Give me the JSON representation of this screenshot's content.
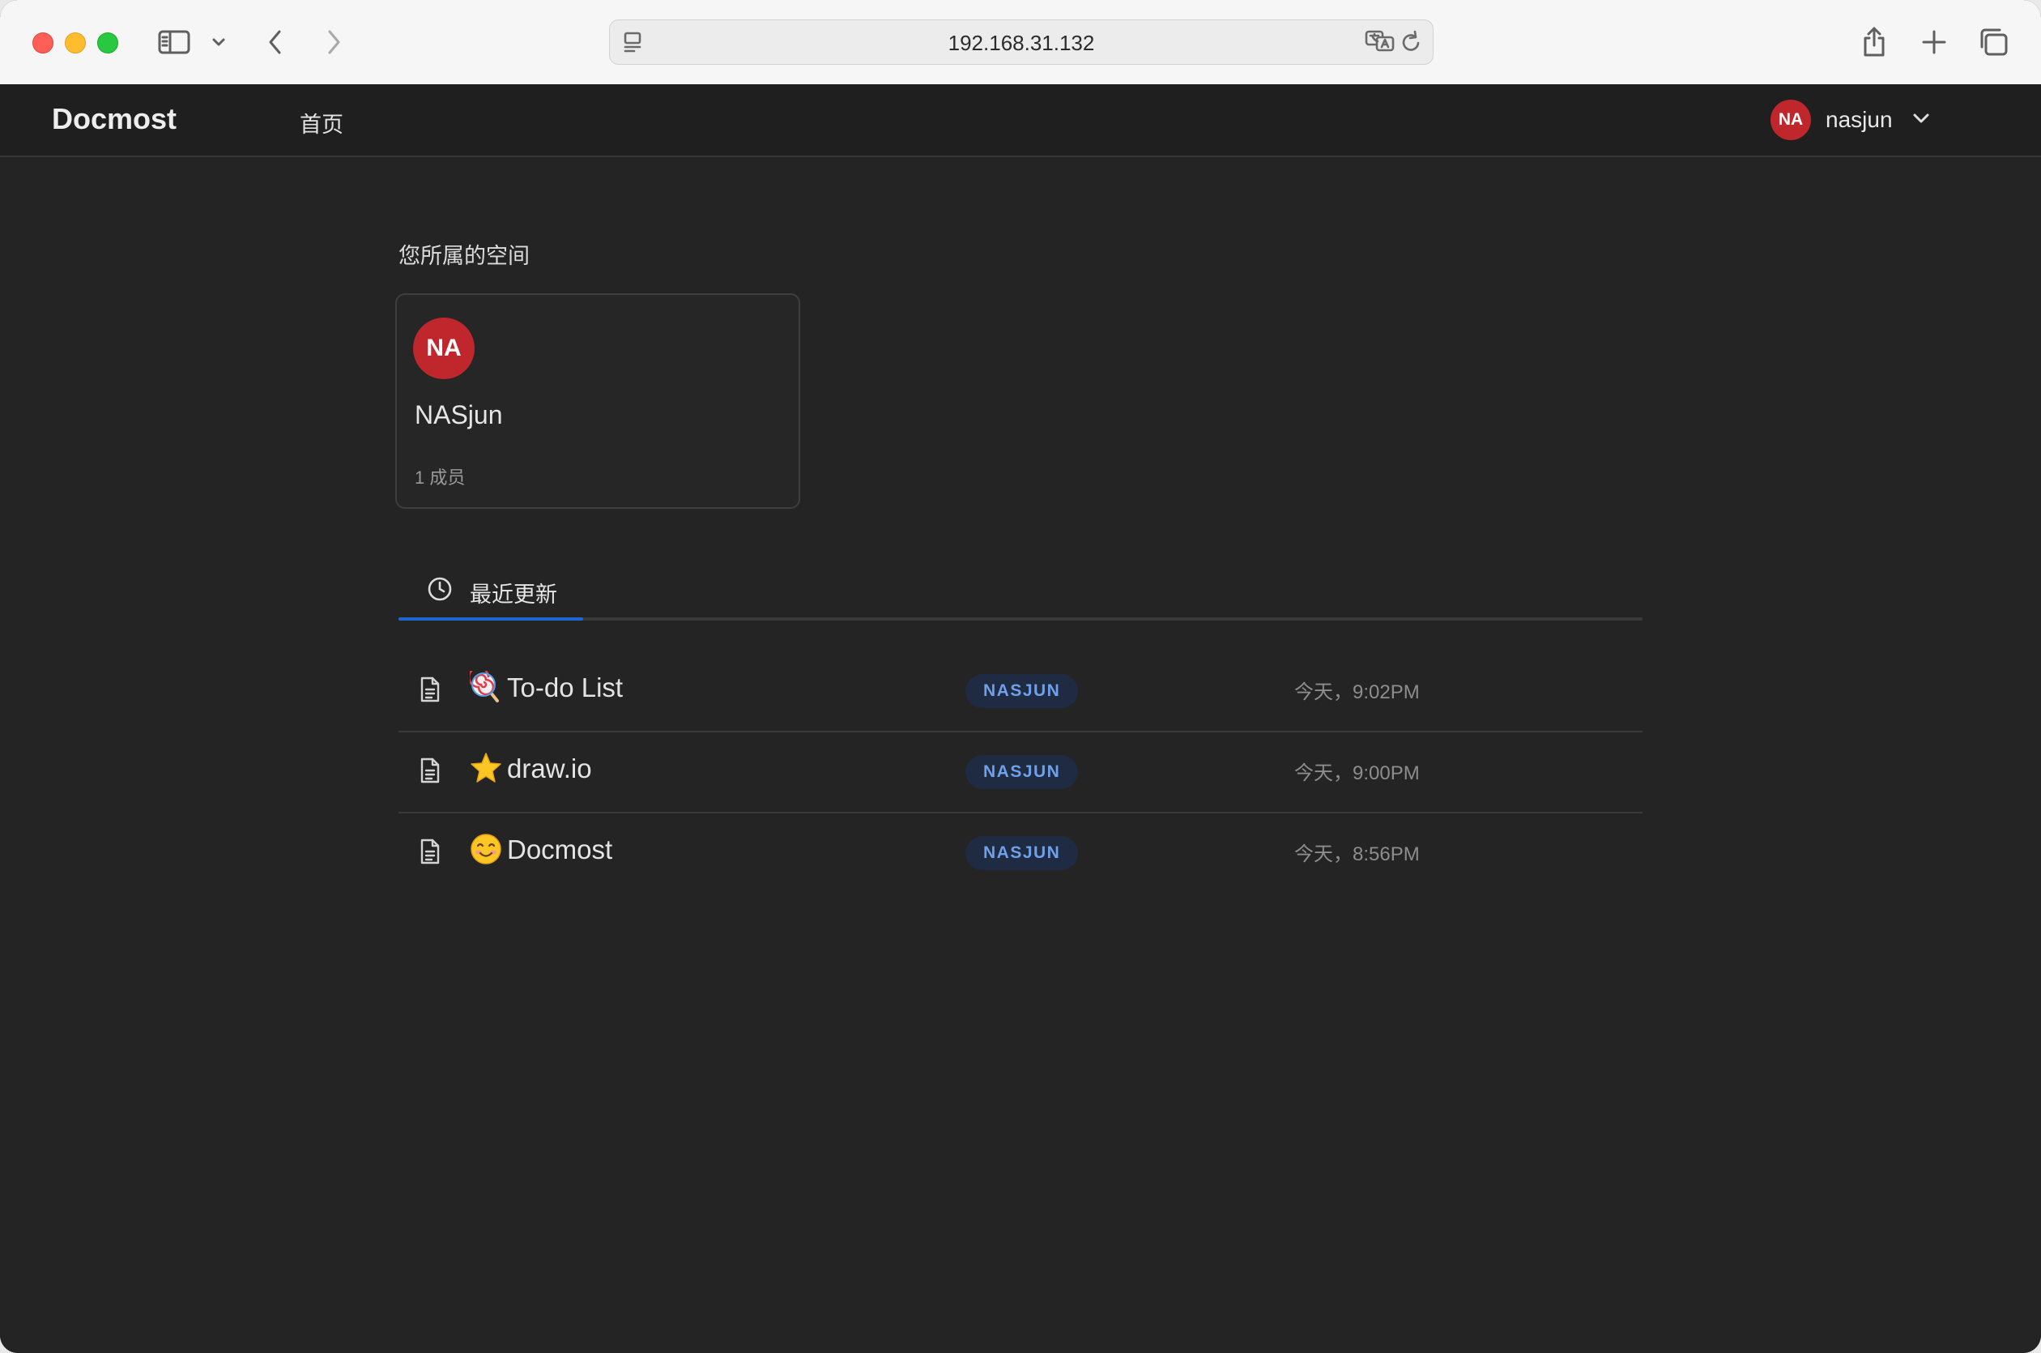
{
  "browser": {
    "url": "192.168.31.132"
  },
  "app": {
    "brand": "Docmost",
    "nav_home": "首页",
    "user": {
      "initials": "NA",
      "name": "nasjun"
    }
  },
  "spaces_section": {
    "title": "您所属的空间",
    "spaces": [
      {
        "initials": "NA",
        "name": "NASjun",
        "members": "1 成员"
      }
    ]
  },
  "recent": {
    "tab_label": "最近更新",
    "pages": [
      {
        "icon": "lollipop-emoji",
        "title": "To-do List",
        "space": "NASJUN",
        "updated": "今天，9:02PM"
      },
      {
        "icon": "star-emoji",
        "title": "draw.io",
        "space": "NASJUN",
        "updated": "今天，9:00PM"
      },
      {
        "icon": "smile-emoji",
        "title": "Docmost",
        "space": "NASJUN",
        "updated": "今天，8:56PM"
      }
    ]
  },
  "colors": {
    "avatar": "#c0272d",
    "accent": "#1f66d1",
    "badge_text": "#6fa0ea",
    "background": "#242424"
  }
}
